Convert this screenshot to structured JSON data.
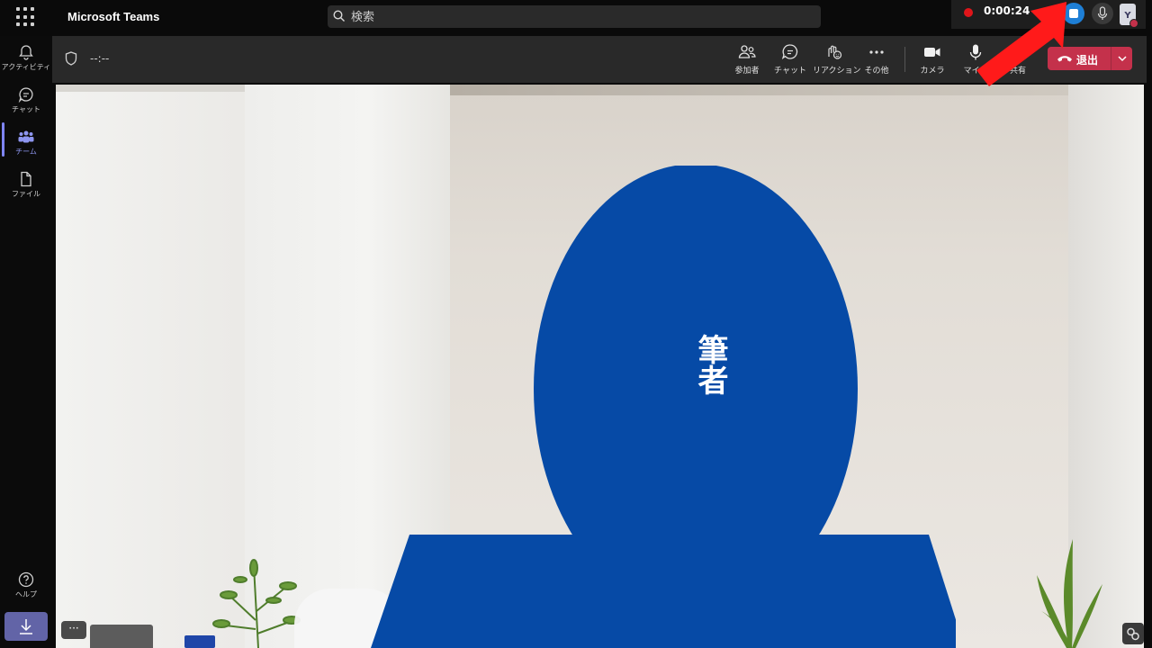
{
  "app": {
    "title": "Microsoft Teams"
  },
  "search": {
    "placeholder": "検索"
  },
  "call_status": {
    "timer": "0:00:24",
    "avatar_initial": "Y"
  },
  "rail": {
    "items": [
      {
        "label": "アクティビティ",
        "icon": "bell-icon"
      },
      {
        "label": "チャット",
        "icon": "chat-icon"
      },
      {
        "label": "チーム",
        "icon": "teams-icon"
      },
      {
        "label": "ファイル",
        "icon": "file-icon"
      }
    ],
    "help_label": "ヘルプ"
  },
  "meeting_bar": {
    "duration": "--:--",
    "buttons": [
      {
        "label": "参加者",
        "icon": "people-icon"
      },
      {
        "label": "チャット",
        "icon": "chat-icon"
      },
      {
        "label": "リアクション",
        "icon": "reaction-icon"
      },
      {
        "label": "その他",
        "icon": "more-icon"
      },
      {
        "label": "カメラ",
        "icon": "camera-icon"
      },
      {
        "label": "マイク",
        "icon": "mic-icon"
      },
      {
        "label": "共有",
        "icon": "share-icon"
      }
    ],
    "leave_label": "退出"
  },
  "stage": {
    "participant_name": "筆者"
  },
  "colors": {
    "accent": "#6264a7",
    "leave": "#c4314b",
    "record": "#e0151a",
    "stop": "#1e7fd6",
    "avatar_blue": "#064aa6",
    "arrow": "#ff1a1a"
  }
}
